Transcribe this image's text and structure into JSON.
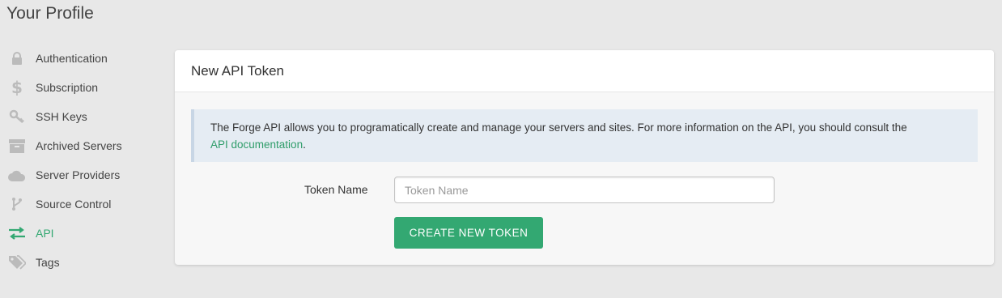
{
  "page": {
    "title": "Your Profile"
  },
  "sidebar": {
    "items": [
      {
        "label": "Authentication",
        "icon": "lock-icon"
      },
      {
        "label": "Subscription",
        "icon": "dollar-icon"
      },
      {
        "label": "SSH Keys",
        "icon": "key-icon"
      },
      {
        "label": "Archived Servers",
        "icon": "archive-icon"
      },
      {
        "label": "Server Providers",
        "icon": "cloud-icon"
      },
      {
        "label": "Source Control",
        "icon": "branch-icon"
      },
      {
        "label": "API",
        "icon": "exchange-icon",
        "active": true
      },
      {
        "label": "Tags",
        "icon": "tags-icon"
      }
    ]
  },
  "panel": {
    "title": "New API Token",
    "info_text": "The Forge API allows you to programatically create and manage your servers and sites. For more information on the API, you should consult the",
    "info_link": "API documentation",
    "info_suffix": ".",
    "form": {
      "token_label": "Token Name",
      "token_value": "",
      "token_placeholder": "Token Name",
      "submit_label": "CREATE NEW TOKEN"
    }
  },
  "colors": {
    "accent": "#33a872",
    "background": "#e8e8e8",
    "info_background": "#e5ecf3",
    "icon_gray": "#bbbbbb"
  }
}
